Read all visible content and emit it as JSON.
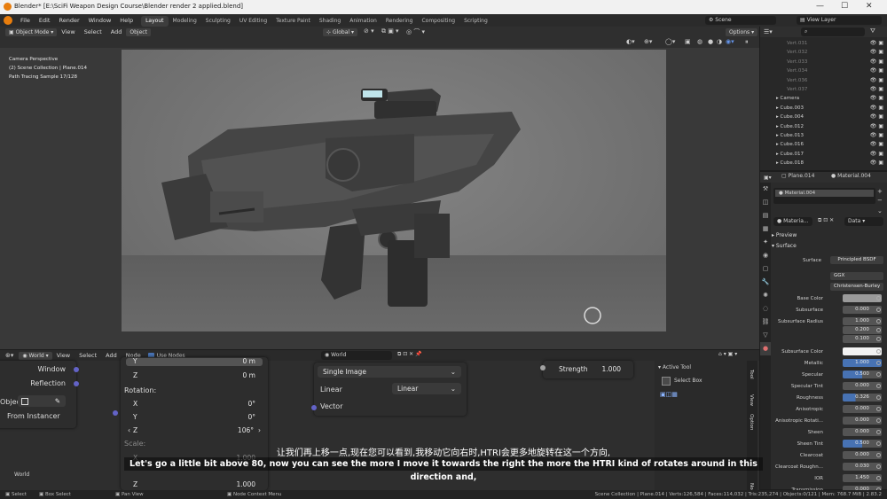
{
  "window": {
    "title": "Blender* [E:\\SciFi Weapon Design Course\\Blender render 2 applied.blend]",
    "minimize": "—",
    "maximize": "☐",
    "close": "✕"
  },
  "menu": [
    "File",
    "Edit",
    "Render",
    "Window",
    "Help"
  ],
  "workspaces": [
    "Layout",
    "Modeling",
    "Sculpting",
    "UV Editing",
    "Texture Paint",
    "Shading",
    "Animation",
    "Rendering",
    "Compositing",
    "Scripting"
  ],
  "scene": {
    "label": "Scene",
    "view_layer": "View Layer"
  },
  "viewport": {
    "mode": "Object Mode",
    "menus": [
      "View",
      "Select",
      "Add",
      "Object"
    ],
    "orientation": "Global",
    "options": "Options",
    "info": [
      "Camera Perspective",
      "(2) Scene Collection | Plane.014",
      "Path Tracing Sample 17/128"
    ]
  },
  "outliner": {
    "vertex_rows": [
      "Vert.031",
      "Vert.032",
      "Vert.033",
      "Vert.034",
      "Vert.036",
      "Vert.037"
    ],
    "object_rows": [
      "Camera",
      "Cube.003",
      "Cube.004",
      "Cube.012",
      "Cube.013",
      "Cube.016",
      "Cube.017",
      "Cube.018"
    ]
  },
  "properties": {
    "object": "Plane.014",
    "material_tab": "Material.004",
    "slot": "Material.004",
    "material_name": "Materia...",
    "data_label": "Data",
    "preview": "Preview",
    "surface_header": "Surface",
    "surface_label": "Surface",
    "surface_value": "Principled BSDF",
    "distribution": "GGX",
    "subsurface_method": "Christensen-Burley",
    "rows": [
      {
        "label": "Base Color",
        "value": ""
      },
      {
        "label": "Subsurface",
        "value": "0.000"
      },
      {
        "label": "Subsurface Radius",
        "value": "1.000"
      },
      {
        "label": "",
        "value": "0.200"
      },
      {
        "label": "",
        "value": "0.100"
      },
      {
        "label": "Subsurface Color",
        "value": ""
      },
      {
        "label": "Metallic",
        "value": "1.000"
      },
      {
        "label": "Specular",
        "value": "0.500"
      },
      {
        "label": "Specular Tint",
        "value": "0.000"
      },
      {
        "label": "Roughness",
        "value": "0.326"
      },
      {
        "label": "Anisotropic",
        "value": "0.000"
      },
      {
        "label": "Anisotropic Rotati...",
        "value": "0.000"
      },
      {
        "label": "Sheen",
        "value": "0.000"
      },
      {
        "label": "Sheen Tint",
        "value": "0.500"
      },
      {
        "label": "Clearcoat",
        "value": "0.000"
      },
      {
        "label": "Clearcoat Roughn...",
        "value": "0.030"
      },
      {
        "label": "IOR",
        "value": "1.450"
      },
      {
        "label": "Transmission",
        "value": "0.000"
      }
    ]
  },
  "node_editor": {
    "world_type": "World",
    "menus": [
      "View",
      "Select",
      "Add",
      "Node"
    ],
    "use_nodes": "Use Nodes",
    "world_name": "World",
    "frame_label": "World",
    "texcoord": {
      "window": "Window",
      "reflection": "Reflection",
      "object": "Object:",
      "from_instancer": "From Instancer"
    },
    "mapping": {
      "y_top": "0 m",
      "z_loc_label": "Z",
      "z_loc": "0 m",
      "rotation": "Rotation:",
      "x_label": "X",
      "x": "0°",
      "y_label": "Y",
      "y": "0°",
      "z_label": "Z",
      "z": "106°",
      "scale": "Scale:",
      "sx_label": "X",
      "sx": "1.000",
      "sz_label": "Z",
      "sz": "1.000"
    },
    "env_tex": {
      "projection": "Single Image",
      "color_space_label": "Color Space",
      "color_space": "Linear",
      "vector": "Vector"
    },
    "background": {
      "strength_label": "Strength",
      "strength": "1.000"
    },
    "sidebar": {
      "active_tool": "Active Tool",
      "select_box": "Select Box",
      "tabs": [
        "Tool",
        "View",
        "Option",
        "Node"
      ]
    }
  },
  "subtitles": {
    "cn": "让我们再上移一点,现在您可以看到,我移动它向右时,HTRI会更多地旋转在这一个方向,",
    "en": "Let's go a little bit above 80, now you can see the more I move it towards the right the more the HTRI kind of rotates around in this direction and,"
  },
  "status": {
    "select": "Select",
    "box_select": "Box Select",
    "pan_view": "Pan View",
    "context_menu": "Node Context Menu",
    "stats": "Scene Collection | Plane.014 | Verts:126,584 | Faces:114,032 | Tris:235,274 | Objects:0/121 | Mem: 768.7 MiB | 2.83.2"
  }
}
